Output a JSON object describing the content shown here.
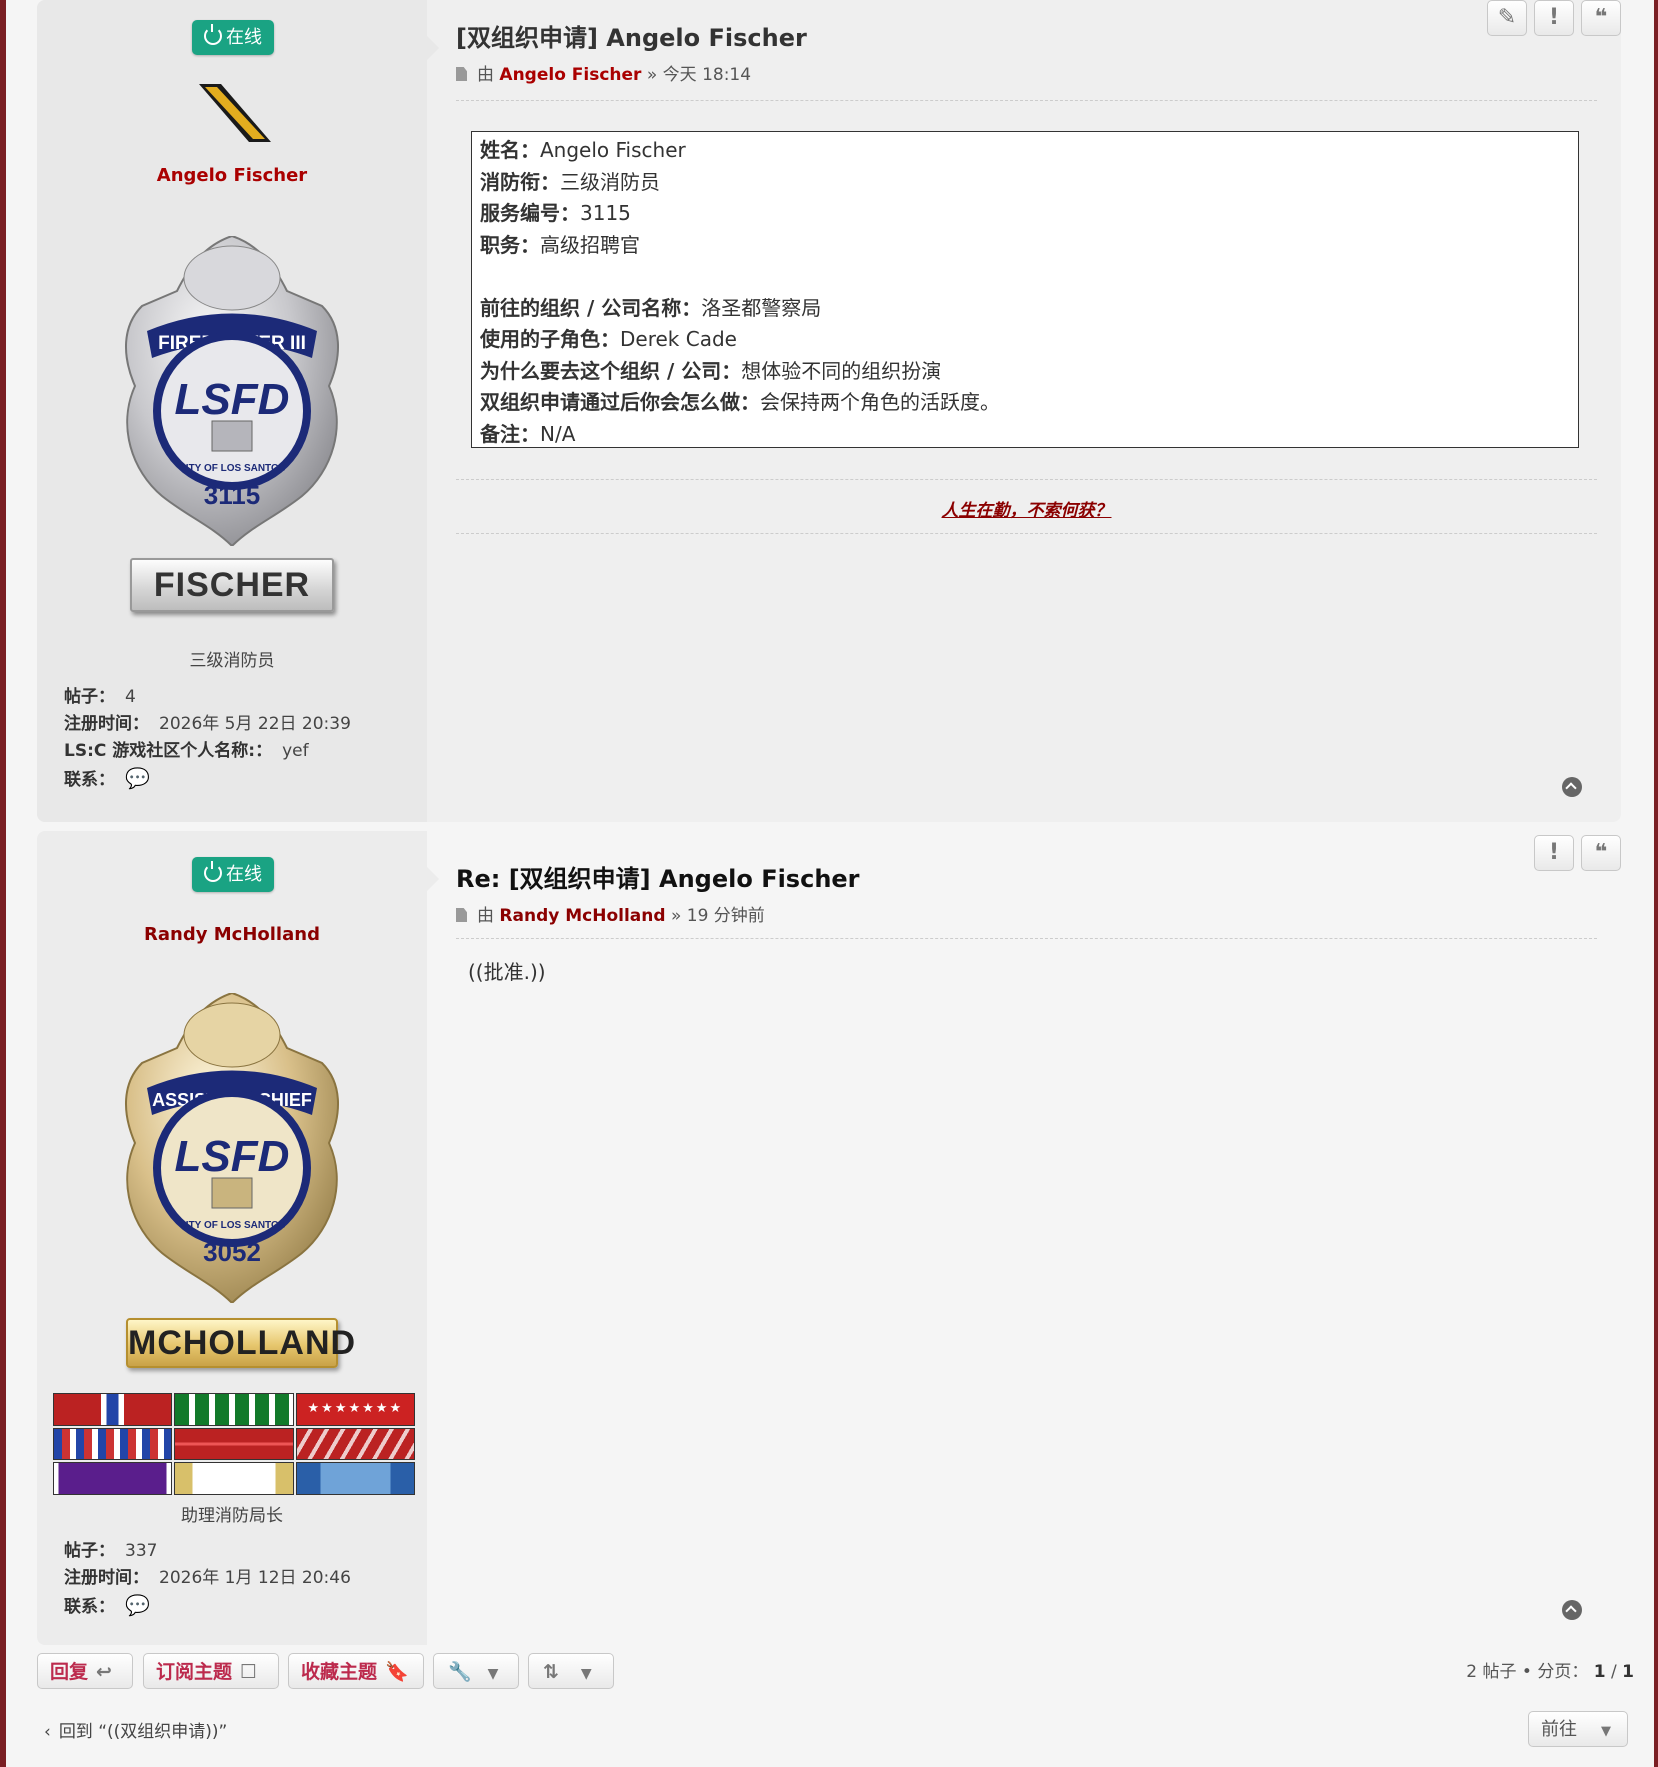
{
  "posts": [
    {
      "status": "在线",
      "username": "Angelo Fischer",
      "badge": {
        "top_text": "FIREFIGHTER III",
        "center": "LSFD",
        "bottom_text": "CITY OF LOS SANTOS",
        "number": "3115",
        "metal_color": "#c8c8cc"
      },
      "nameplate": "FISCHER",
      "rank_title": "三级消防员",
      "stats": {
        "posts_label": "帖子：",
        "posts_value": "4",
        "joined_label": "注册时间：",
        "joined_value": "2026年 5月 22日 20:39",
        "lsc_label": "LS:C 游戏社区个人名称:：",
        "lsc_value": "yef",
        "contact_label": "联系："
      },
      "title": "[双组织申请] Angelo Fischer",
      "by": "由",
      "author": "Angelo Fischer",
      "time": "» 今天 18:14",
      "form": [
        {
          "k": "姓名：",
          "v": "Angelo Fischer"
        },
        {
          "k": "消防衔：",
          "v": "三级消防员"
        },
        {
          "k": "服务编号：",
          "v": "3115"
        },
        {
          "k": "职务：",
          "v": "高级招聘官"
        },
        {
          "k": "",
          "v": ""
        },
        {
          "k": "前往的组织 / 公司名称：",
          "v": "洛圣都警察局"
        },
        {
          "k": "使用的子角色：",
          "v": "Derek Cade"
        },
        {
          "k": "为什么要去这个组织 / 公司：",
          "v": "想体验不同的组织扮演"
        },
        {
          "k": "双组织申请通过后你会怎么做：",
          "v": "会保持两个角色的活跃度。"
        },
        {
          "k": "备注：",
          "v": "N/A"
        }
      ],
      "signature": "人生在勤，不索何获？",
      "actions": [
        "edit-icon",
        "report-icon",
        "quote-icon"
      ]
    },
    {
      "status": "在线",
      "username": "Randy McHolland",
      "badge": {
        "top_text": "ASSISTANT CHIEF",
        "center": "LSFD",
        "bottom_text": "CITY OF LOS SANTOS",
        "number": "3052",
        "metal_color": "#d9c08a"
      },
      "nameplate": "MCHOLLAND",
      "rank_title": "助理消防局长",
      "stats": {
        "posts_label": "帖子：",
        "posts_value": "337",
        "joined_label": "注册时间：",
        "joined_value": "2026年 1月 12日 20:46",
        "contact_label": "联系："
      },
      "title": "Re: [双组织申请] Angelo Fischer",
      "by": "由",
      "author": "Randy McHolland",
      "time": "» 19 分钟前",
      "body": "((批准.))",
      "actions": [
        "report-icon",
        "quote-icon"
      ]
    }
  ],
  "toolbar": {
    "reply": "回复",
    "subscribe": "订阅主题",
    "bookmark": "收藏主题"
  },
  "pagination": {
    "summary": "2 帖子 • 分页：",
    "current": "1",
    "sep": "/",
    "total": "1"
  },
  "back_link": "回到 “((双组织申请))”",
  "jump": "前往",
  "colors": {
    "accent": "#bc2a4d",
    "online": "#1aa383",
    "username": "#aa0000",
    "frame": "#7a1f24"
  }
}
